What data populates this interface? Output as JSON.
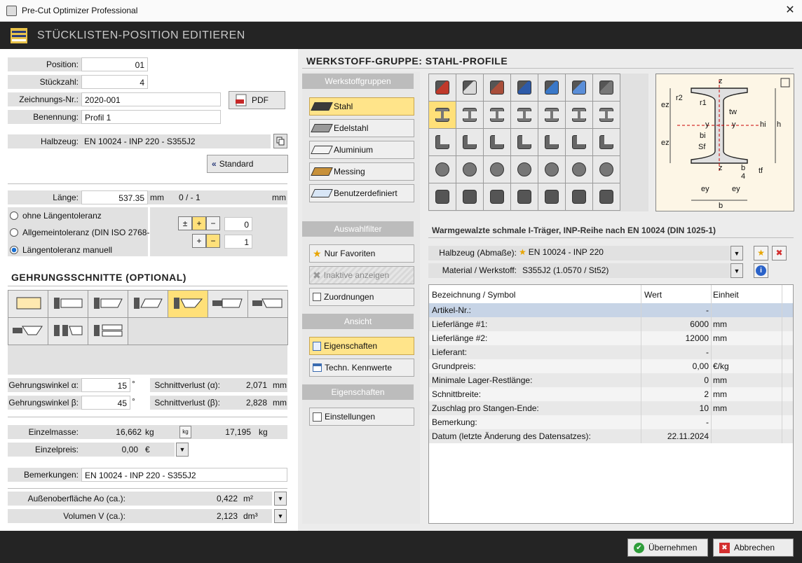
{
  "window": {
    "title": "Pre-Cut Optimizer Professional",
    "close": "✕"
  },
  "header": {
    "title": "STÜCKLISTEN-POSITION EDITIEREN"
  },
  "fields": {
    "position": {
      "label": "Position:",
      "value": "01"
    },
    "stueckzahl": {
      "label": "Stückzahl:",
      "value": "4"
    },
    "zeichnung": {
      "label": "Zeichnungs-Nr.:",
      "value": "2020-001"
    },
    "benennung": {
      "label": "Benennung:",
      "value": "Profil 1"
    },
    "halbzeug": {
      "label": "Halbzeug:",
      "value": "EN 10024 - INP 220 - S355J2"
    },
    "laenge": {
      "label": "Länge:",
      "value": "537.35",
      "unit": "mm",
      "range": "0 / - 1",
      "unit2": "mm"
    }
  },
  "buttons": {
    "pdf": "PDF",
    "standard": "Standard",
    "ok": "Übernehmen",
    "cancel": "Abbrechen"
  },
  "tolerance": {
    "options": [
      "ohne Längentoleranz",
      "Allgemeintoleranz (DIN ISO 2768-1)",
      "Längentoleranz manuell"
    ],
    "selected": 2,
    "upper": "0",
    "lower": "1",
    "row1": [
      "±",
      "+",
      "−"
    ],
    "row2": [
      "+",
      "−"
    ]
  },
  "gehrung": {
    "title": "GEHRUNGSSCHNITTE (OPTIONAL)",
    "alpha": {
      "label": "Gehrungswinkel α:",
      "value": "15",
      "unit": "°"
    },
    "beta": {
      "label": "Gehrungswinkel β:",
      "value": "45",
      "unit": "°"
    },
    "verlust_a": {
      "label": "Schnittverlust (α):",
      "value": "2,071",
      "unit": "mm"
    },
    "verlust_b": {
      "label": "Schnittverlust (β):",
      "value": "2,828",
      "unit": "mm"
    }
  },
  "masse": {
    "einzelmasse": {
      "label": "Einzelmasse:",
      "value": "16,662",
      "unit": "kg",
      "value2": "17,195",
      "unit2": "kg"
    },
    "einzelpreis": {
      "label": "Einzelpreis:",
      "value": "0,00",
      "unit": "€"
    },
    "bemerkungen": {
      "label": "Bemerkungen:",
      "value": "EN 10024 - INP 220 - S355J2"
    },
    "oberflaeche": {
      "label": "Außenoberfläche Ao (ca.):",
      "value": "0,422",
      "unit": "m²"
    },
    "volumen": {
      "label": "Volumen V (ca.):",
      "value": "2,123",
      "unit": "dm³"
    }
  },
  "werkstoff": {
    "title": "WERKSTOFF-GRUPPE: STAHL-PROFILE",
    "groups_header": "Werkstoffgruppen",
    "groups": [
      {
        "label": "Stahl",
        "color": "#3a3a3a"
      },
      {
        "label": "Edelstahl",
        "color": "#9a9a9a"
      },
      {
        "label": "Aluminium",
        "color": "#f4f4f4"
      },
      {
        "label": "Messing",
        "color": "#c8913a"
      },
      {
        "label": "Benutzerdefiniert",
        "color": "#d8e6f6"
      }
    ],
    "filter_header": "Auswahlfilter",
    "filters": [
      "Nur Favoriten",
      "Inaktive anzeigen",
      "Zuordnungen"
    ],
    "ansicht_header": "Ansicht",
    "ansicht": [
      "Eigenschaften",
      "Techn. Kennwerte"
    ],
    "eigen_header": "Eigenschaften",
    "eigen": [
      "Einstellungen"
    ]
  },
  "profile": {
    "caption": "Warmgewalzte schmale I-Träger, INP-Reihe nach EN 10024 (DIN 1025-1)",
    "halbzeug_label": "Halbzeug (Abmaße):",
    "halbzeug_value": "EN 10024 - INP 220",
    "material_label": "Material / Werkstoff:",
    "material_value": "S355J2  (1.0570 / St52)",
    "drawing_labels": [
      "z",
      "r2",
      "r1",
      "tw",
      "ez",
      "y",
      "y",
      "hi",
      "h",
      "bi",
      "Sf",
      "ez",
      "z",
      "b",
      "4",
      "tf",
      "ey",
      "ey",
      "b"
    ]
  },
  "table": {
    "headers": [
      "Bezeichnung / Symbol",
      "Wert",
      "Einheit"
    ],
    "rows": [
      [
        "Artikel-Nr.:",
        "-",
        ""
      ],
      [
        "Lieferlänge #1:",
        "6000",
        "mm"
      ],
      [
        "Lieferlänge #2:",
        "12000",
        "mm"
      ],
      [
        "Lieferant:",
        "-",
        ""
      ],
      [
        "Grundpreis:",
        "0,00",
        "€/kg"
      ],
      [
        "Minimale Lager-Restlänge:",
        "0",
        "mm"
      ],
      [
        "Schnittbreite:",
        "2",
        "mm"
      ],
      [
        "Zuschlag pro Stangen-Ende:",
        "10",
        "mm"
      ],
      [
        "Bemerkung:",
        "-",
        ""
      ],
      [
        "Datum (letzte Änderung des Datensatzes):",
        "22.11.2024",
        ""
      ]
    ]
  }
}
